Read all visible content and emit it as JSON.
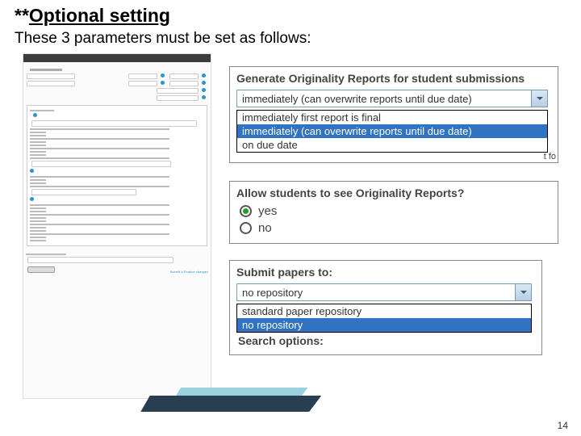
{
  "title_prefix": "**",
  "title_main": "Optional setting",
  "subtitle": "These 3 parameters must be set as follows:",
  "blur": {
    "header": "New Assignment"
  },
  "panel1": {
    "title": "Generate Originality Reports for student submissions",
    "selected": "immediately (can overwrite reports until due date)",
    "options": [
      "immediately first report is final",
      "immediately (can overwrite reports until due date)",
      "on due date"
    ],
    "selected_index": 1,
    "cutoff_text": "t fo"
  },
  "panel2": {
    "title": "Allow students to see Originality Reports?",
    "yes": "yes",
    "no": "no"
  },
  "panel3": {
    "title": "Submit papers to:",
    "selected": "no repository",
    "options": [
      "standard paper repository",
      "no repository"
    ],
    "selected_index": 1,
    "search_options": "Search options:"
  },
  "page_number": "14"
}
